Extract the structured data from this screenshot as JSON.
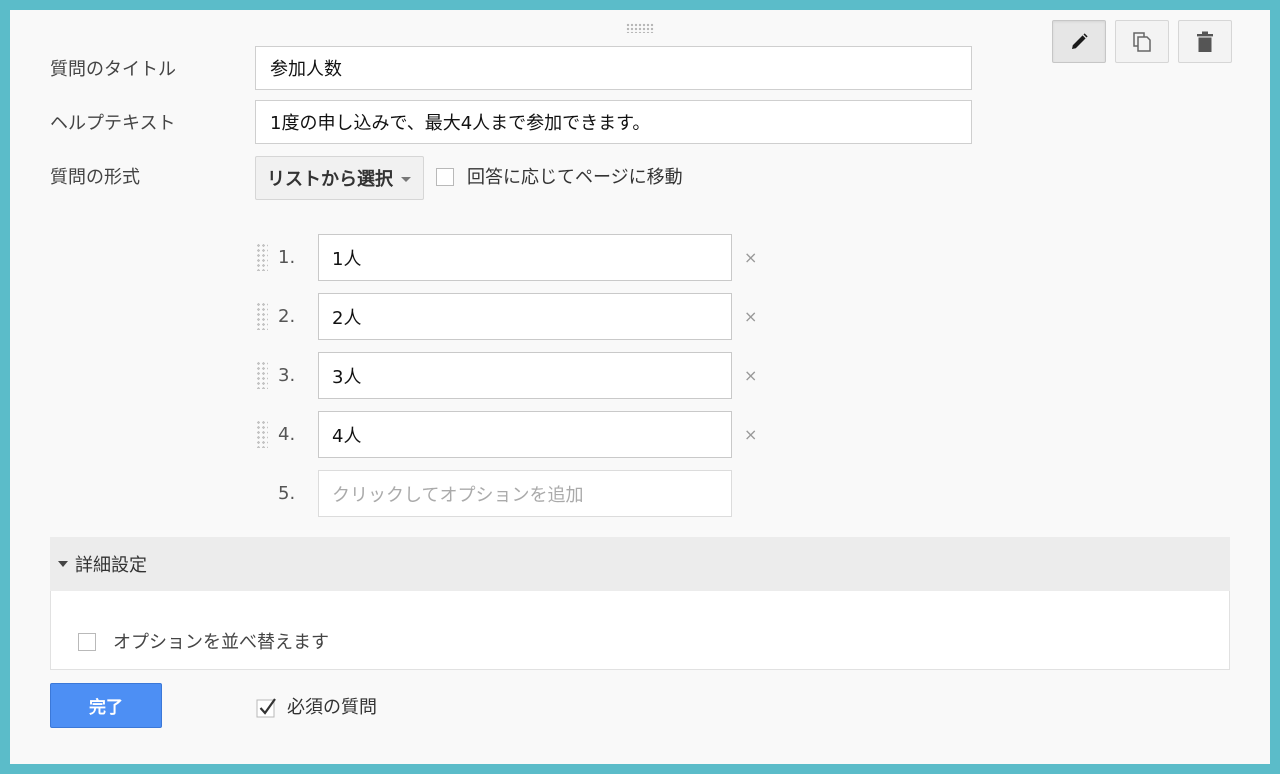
{
  "form": {
    "title_label": "質問のタイトル",
    "title_value": "参加人数",
    "help_label": "ヘルプテキスト",
    "help_value": "1度の申し込みで、最大4人まで参加できます。",
    "type_label": "質問の形式",
    "type_value": "リストから選択",
    "goto_page_label": "回答に応じてページに移動",
    "goto_page_checked": false
  },
  "toolbar": {
    "edit_icon": "pencil-icon",
    "duplicate_icon": "copy-icon",
    "delete_icon": "trash-icon"
  },
  "options": [
    {
      "number": "1.",
      "value": "1人",
      "remove": "×"
    },
    {
      "number": "2.",
      "value": "2人",
      "remove": "×"
    },
    {
      "number": "3.",
      "value": "3人",
      "remove": "×"
    },
    {
      "number": "4.",
      "value": "4人",
      "remove": "×"
    }
  ],
  "add_option": {
    "number": "5.",
    "placeholder": "クリックしてオプションを追加"
  },
  "advanced": {
    "title": "詳細設定",
    "shuffle_label": "オプションを並べ替えます",
    "shuffle_checked": false
  },
  "footer": {
    "done_label": "完了",
    "required_label": "必須の質問",
    "required_checked": true
  },
  "colors": {
    "frame": "#5bbcc9",
    "primary_button": "#4d8ff4"
  }
}
